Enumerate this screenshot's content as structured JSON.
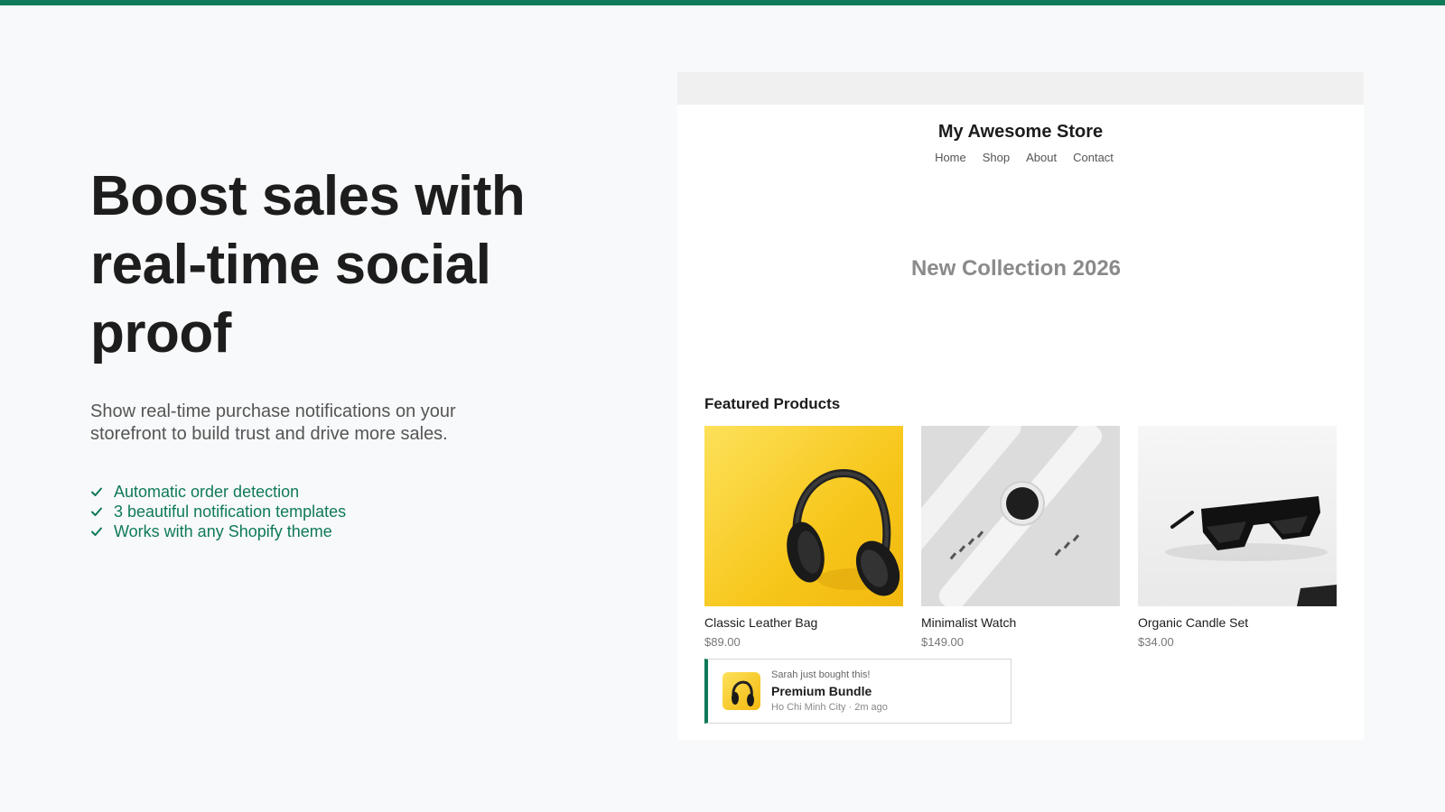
{
  "hero": {
    "headline_line1": "Boost sales with",
    "headline_line2": "real-time social",
    "headline_line3": "proof",
    "subtitle": "Show real-time purchase notifications on your storefront to build trust and drive more sales.",
    "features": [
      "Automatic order detection",
      "3 beautiful notification templates",
      "Works with any Shopify theme"
    ]
  },
  "store": {
    "title": "My Awesome Store",
    "nav": [
      "Home",
      "Shop",
      "About",
      "Contact"
    ],
    "banner": "New Collection 2026",
    "featured_title": "Featured Products",
    "products": [
      {
        "name": "Classic Leather Bag",
        "price": "$89.00",
        "image": "headphones-image"
      },
      {
        "name": "Minimalist Watch",
        "price": "$149.00",
        "image": "watch-image"
      },
      {
        "name": "Organic Candle Set",
        "price": "$34.00",
        "image": "sunglasses-image"
      }
    ]
  },
  "notification": {
    "headline": "Sarah just bought this!",
    "product": "Premium Bundle",
    "location": "Ho Chi Minh City",
    "separator": "·",
    "time": "2m ago"
  },
  "colors": {
    "accent": "#0f7a5a",
    "background": "#f8f9fa",
    "heading": "#1d1d1d"
  }
}
